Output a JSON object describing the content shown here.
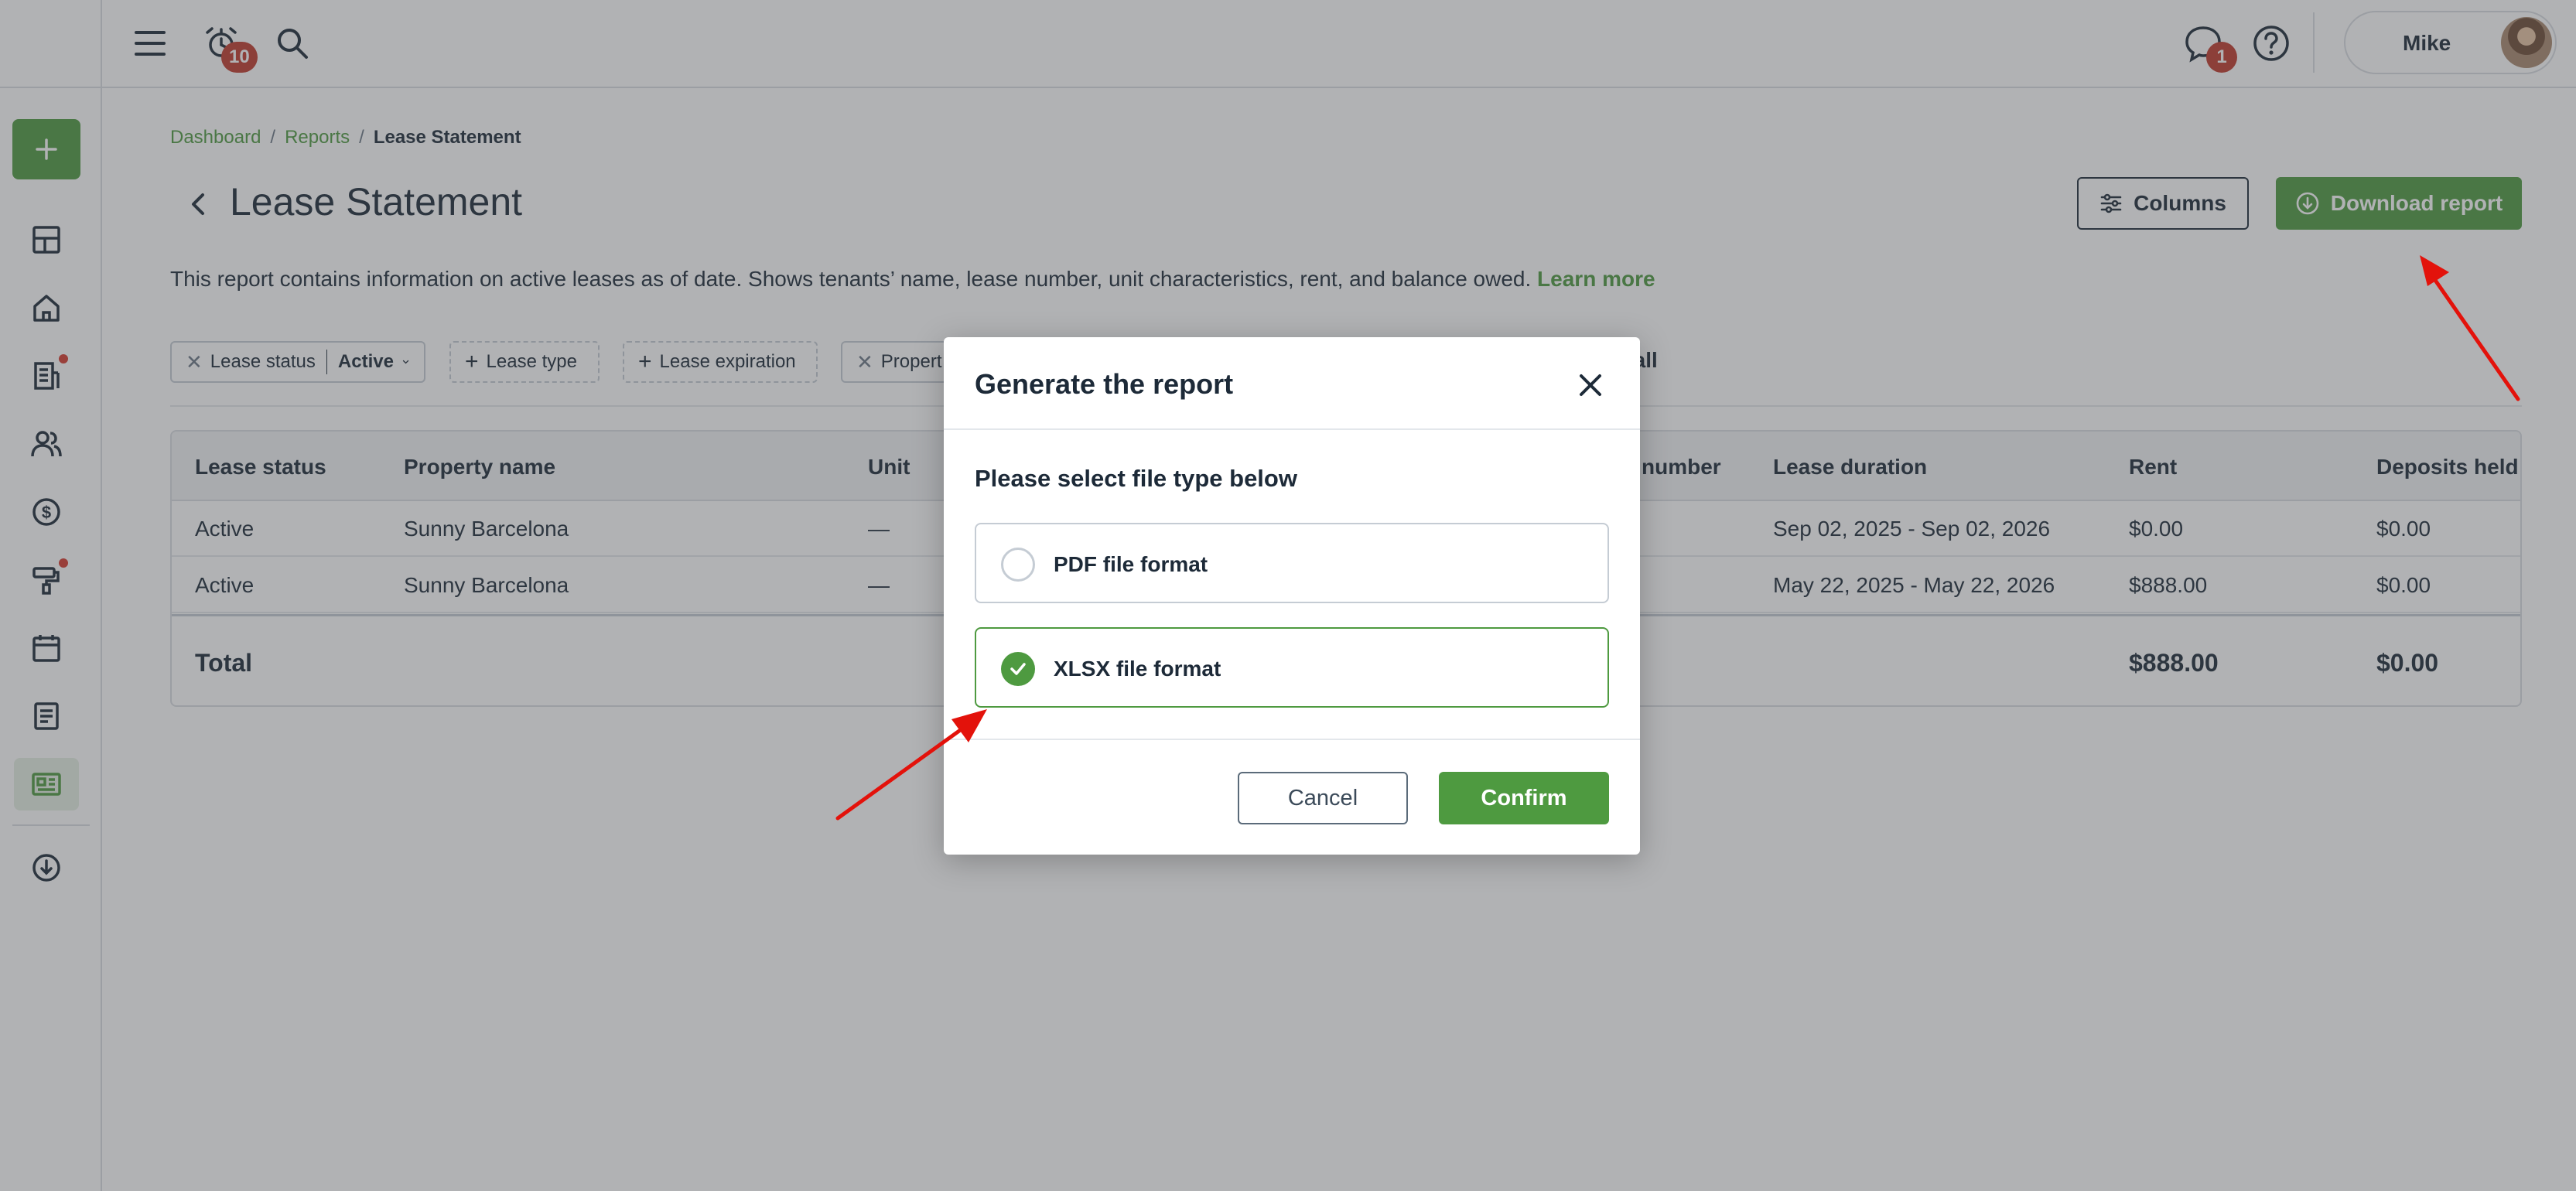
{
  "topbar": {
    "notifications_count": "10",
    "messages_count": "1",
    "user_name": "Mike"
  },
  "breadcrumb": {
    "items": [
      "Dashboard",
      "Reports"
    ],
    "current": "Lease Statement",
    "separator": "/"
  },
  "page": {
    "title": "Lease Statement",
    "description": "This report contains information on active leases as of date. Shows tenants’ name, lease number, unit characteristics, rent, and balance owed.",
    "learn_more": "Learn more",
    "columns_label": "Columns",
    "download_label": "Download report"
  },
  "filters": {
    "lease_status_label": "Lease status",
    "lease_status_value": "Active",
    "lease_type": "Lease type",
    "lease_expiration": "Lease expiration",
    "property_partial": "Propert",
    "clear_all_partial": "r all"
  },
  "table": {
    "headers": [
      "Lease status",
      "Property name",
      "Unit",
      "number",
      "Lease duration",
      "Rent",
      "Deposits held"
    ],
    "rows": [
      [
        "Active",
        "Sunny Barcelona",
        "—",
        "Sep 02, 2025 - Sep 02, 2026",
        "$0.00",
        "$0.00"
      ],
      [
        "Active",
        "Sunny Barcelona",
        "—",
        "May 22, 2025 - May 22, 2026",
        "$888.00",
        "$0.00"
      ]
    ],
    "total_label": "Total",
    "total_rent": "$888.00",
    "total_deposits": "$0.00"
  },
  "modal": {
    "title": "Generate the report",
    "subtitle": "Please select file type below",
    "options": [
      {
        "label": "PDF file format",
        "selected": false
      },
      {
        "label": "XLSX file format",
        "selected": true
      }
    ],
    "cancel_label": "Cancel",
    "confirm_label": "Confirm"
  },
  "colors": {
    "accent_green": "#4e9a40",
    "badge_red": "#c0392b",
    "annotation_red": "#e3120b",
    "text_dark": "#1d2a38"
  },
  "icons": [
    "menu-icon",
    "alarm-clock-icon",
    "search-icon",
    "chat-icon",
    "help-icon",
    "plus-icon",
    "dashboard-icon",
    "home-icon",
    "building-icon",
    "users-icon",
    "dollar-icon",
    "paint-roller-icon",
    "calendar-icon",
    "document-icon",
    "reports-icon",
    "cloud-download-icon",
    "chevron-left-icon",
    "sliders-icon",
    "close-icon",
    "check-icon",
    "chevron-down-icon"
  ]
}
